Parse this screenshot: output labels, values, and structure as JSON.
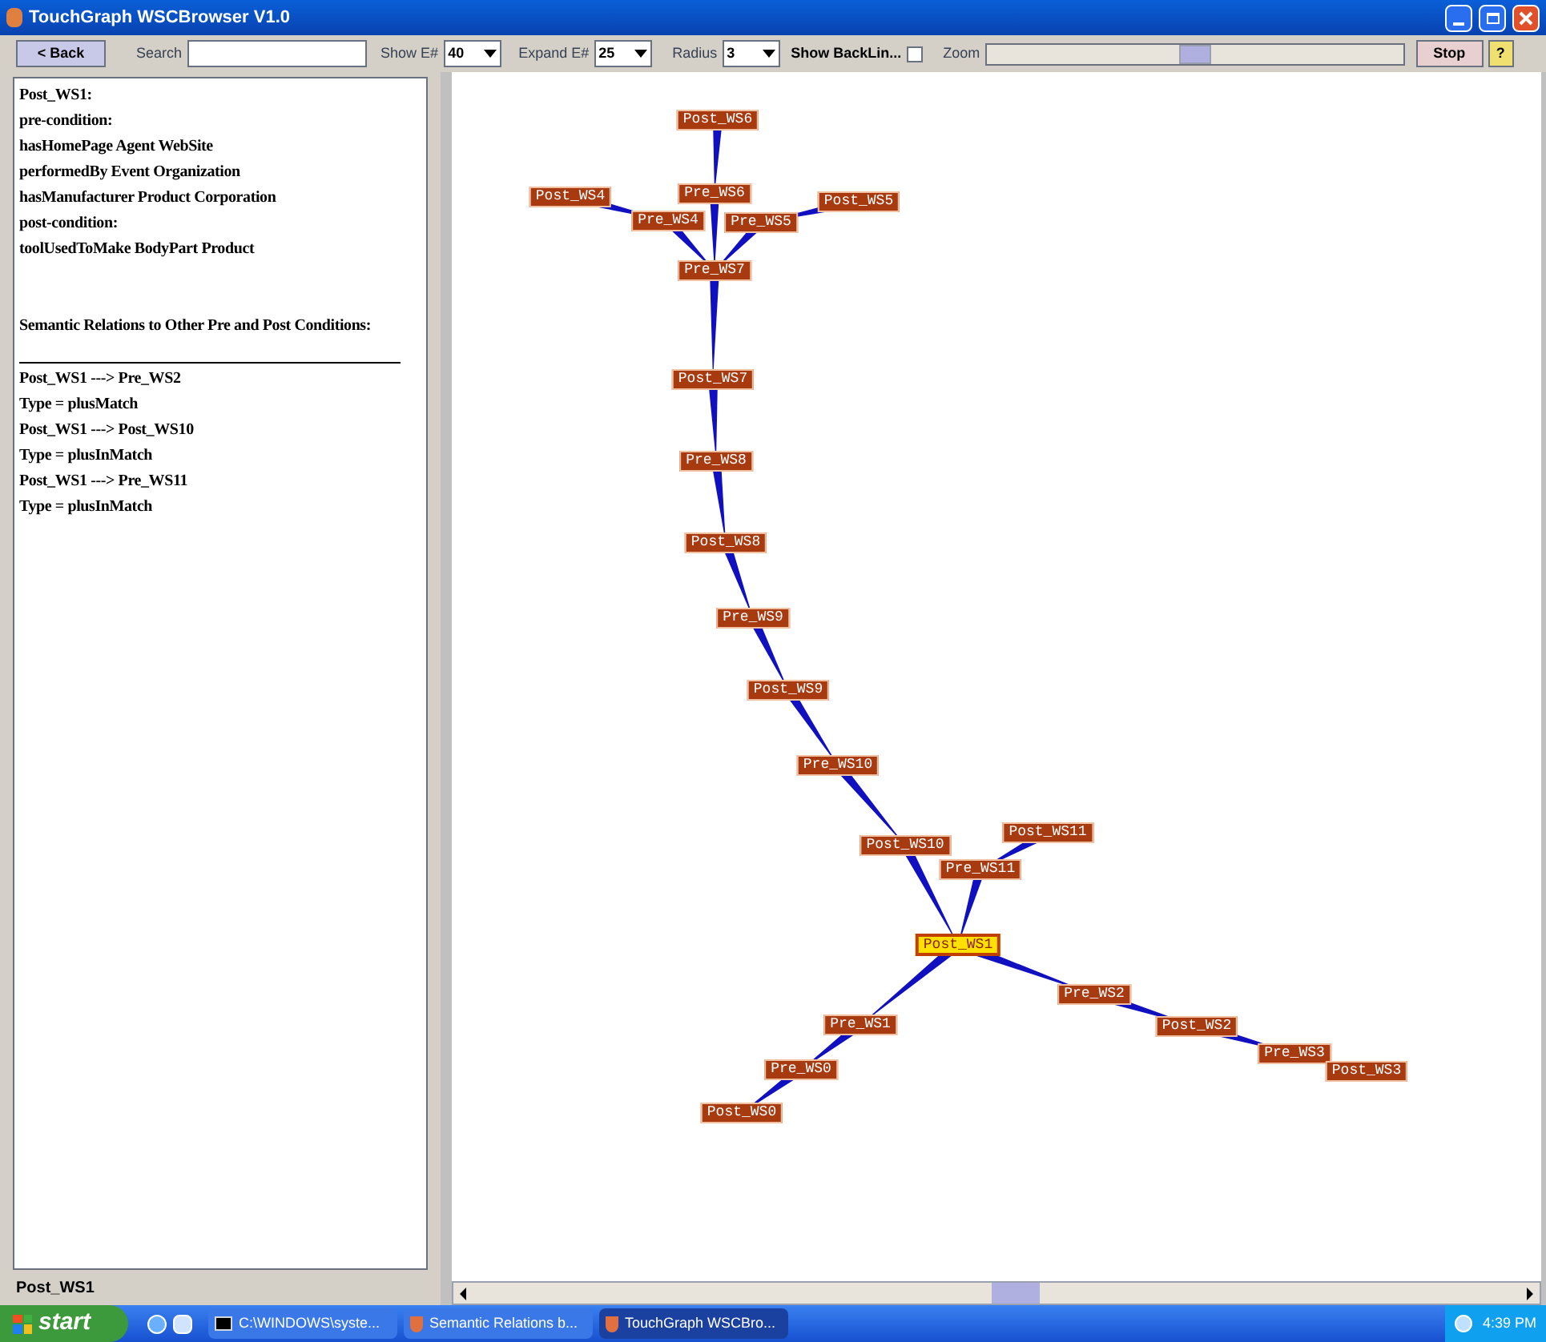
{
  "window": {
    "title": "TouchGraph WSCBrowser V1.0"
  },
  "toolbar": {
    "back": "< Back",
    "search_label": "Search",
    "show_label": "Show E#",
    "show_value": "40",
    "expand_label": "Expand E#",
    "expand_value": "25",
    "radius_label": "Radius",
    "radius_value": "3",
    "backlinks_label": "Show BackLin...",
    "backlinks_checked": false,
    "zoom_label": "Zoom",
    "zoom": {
      "level": 0.5
    },
    "stop": "Stop",
    "help": "?"
  },
  "info_panel": {
    "lines": [
      "Post_WS1:",
      "pre-condition:",
      "hasHomePage Agent WebSite",
      "performedBy Event Organization",
      "hasManufacturer Product Corporation",
      "post-condition:",
      "toolUsedToMake BodyPart Product"
    ],
    "relations_heading": "Semantic Relations to Other Pre and Post Conditions:",
    "relations": [
      "Post_WS1 ---> Pre_WS2",
      "Type = plusMatch",
      "Post_WS1 ---> Post_WS10",
      "Type = plusInMatch",
      "Post_WS1 ---> Pre_WS11",
      "Type = plusInMatch"
    ]
  },
  "status": "Post_WS1",
  "graph": {
    "nodes": [
      {
        "label": "Post_WS6",
        "selected": false
      },
      {
        "label": "Pre_WS6",
        "selected": false
      },
      {
        "label": "Post_WS4",
        "selected": false
      },
      {
        "label": "Pre_WS4",
        "selected": false
      },
      {
        "label": "Pre_WS5",
        "selected": false
      },
      {
        "label": "Post_WS5",
        "selected": false
      },
      {
        "label": "Pre_WS7",
        "selected": false
      },
      {
        "label": "Post_WS7",
        "selected": false
      },
      {
        "label": "Pre_WS8",
        "selected": false
      },
      {
        "label": "Post_WS8",
        "selected": false
      },
      {
        "label": "Pre_WS9",
        "selected": false
      },
      {
        "label": "Post_WS9",
        "selected": false
      },
      {
        "label": "Pre_WS10",
        "selected": false
      },
      {
        "label": "Post_WS10",
        "selected": false
      },
      {
        "label": "Post_WS11",
        "selected": false
      },
      {
        "label": "Pre_WS11",
        "selected": false
      },
      {
        "label": "Post_WS1",
        "selected": true
      },
      {
        "label": "Pre_WS2",
        "selected": false
      },
      {
        "label": "Post_WS2",
        "selected": false
      },
      {
        "label": "Pre_WS3",
        "selected": false
      },
      {
        "label": "Post_WS3",
        "selected": false
      },
      {
        "label": "Pre_WS1",
        "selected": false
      },
      {
        "label": "Pre_WS0",
        "selected": false
      },
      {
        "label": "Post_WS0",
        "selected": false
      }
    ]
  },
  "taskbar": {
    "start": "start",
    "items": [
      {
        "label": "C:\\WINDOWS\\syste...",
        "kind": "console",
        "selected": false
      },
      {
        "label": "Semantic Relations b...",
        "kind": "java",
        "selected": false
      },
      {
        "label": "TouchGraph WSCBro...",
        "kind": "java",
        "selected": true
      }
    ],
    "clock": "4:39 PM"
  }
}
